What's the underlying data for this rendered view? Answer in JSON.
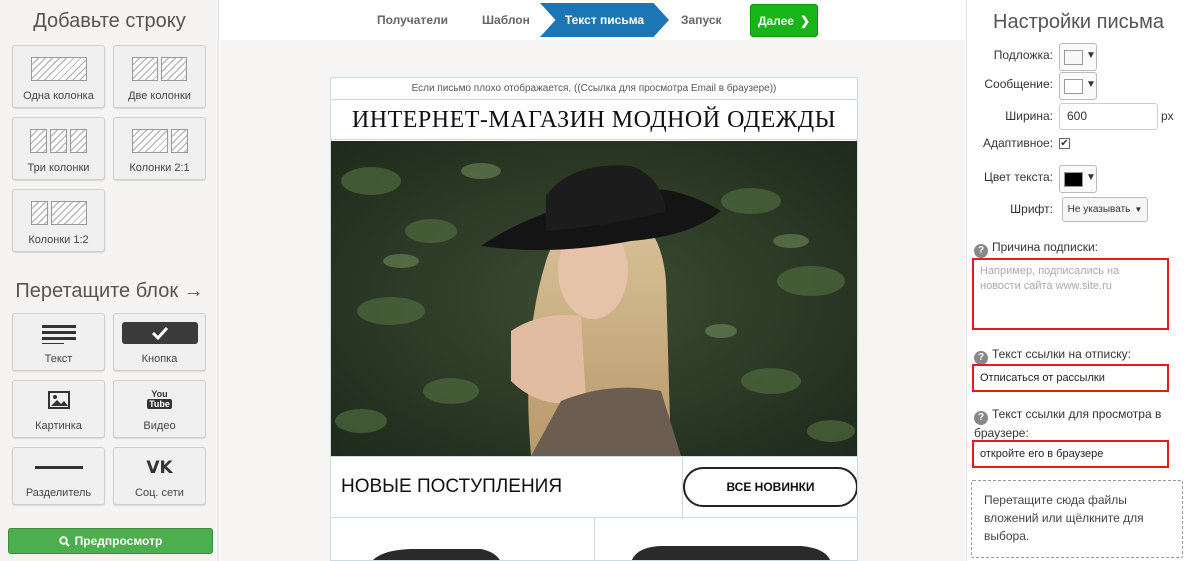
{
  "left_panel": {
    "rows_title": "Добавьте строку",
    "row_layouts": [
      {
        "label": "Одна колонка"
      },
      {
        "label": "Две колонки"
      },
      {
        "label": "Три колонки"
      },
      {
        "label": "Колонки 2:1"
      },
      {
        "label": "Колонки 1:2"
      }
    ],
    "blocks_title": "Перетащите блок →",
    "blocks": [
      {
        "label": "Текст",
        "icon": "text-lines-icon"
      },
      {
        "label": "Кнопка",
        "icon": "button-check-icon"
      },
      {
        "label": "Картинка",
        "icon": "image-icon"
      },
      {
        "label": "Видео",
        "icon": "youtube-icon",
        "icon_text": "You Tube"
      },
      {
        "label": "Разделитель",
        "icon": "divider-line-icon"
      },
      {
        "label": "Соц. сети",
        "icon": "vk-icon",
        "icon_text": "VK"
      }
    ],
    "preview_button": "Предпросмотр"
  },
  "steps": {
    "items": [
      {
        "label": "Получатели"
      },
      {
        "label": "Шаблон"
      },
      {
        "label": "Текст письма",
        "active": true
      },
      {
        "label": "Запуск"
      }
    ],
    "next_button": "Далее",
    "active_color": "#1d76b4",
    "next_color": "#18b518"
  },
  "email": {
    "view_in_browser": "Если письмо плохо отображается, ((Ссылка для просмотра Email в браузере))",
    "shop_title": "ИНТЕРНЕТ-МАГАЗИН МОДНОЙ ОДЕЖДЫ",
    "new_arrivals": "НОВЫЕ ПОСТУПЛЕНИЯ",
    "all_new_button": "ВСЕ НОВИНКИ"
  },
  "settings": {
    "title": "Настройки письма",
    "background_label": "Подложка:",
    "message_label": "Сообщение:",
    "width_label": "Ширина:",
    "width_value": "600",
    "width_unit": "px",
    "adaptive_label": "Адаптивное:",
    "adaptive_checked": true,
    "text_color_label": "Цвет текста:",
    "text_color": "#000000",
    "font_label": "Шрифт:",
    "font_value": "Не указывать",
    "reason_label": "Причина подписки:",
    "reason_placeholder": "Например, подписались на новости сайта www.site.ru",
    "unsubscribe_label": "Текст ссылки на отписку:",
    "unsubscribe_value": "Отписаться от рассылки",
    "browser_link_label": "Текст ссылки для просмотра в браузере:",
    "browser_link_value": "откройте его в браузере",
    "attachments_text": "Перетащите сюда файлы вложений или щёлкните для выбора.",
    "highlight_color": "#e21d1d"
  }
}
